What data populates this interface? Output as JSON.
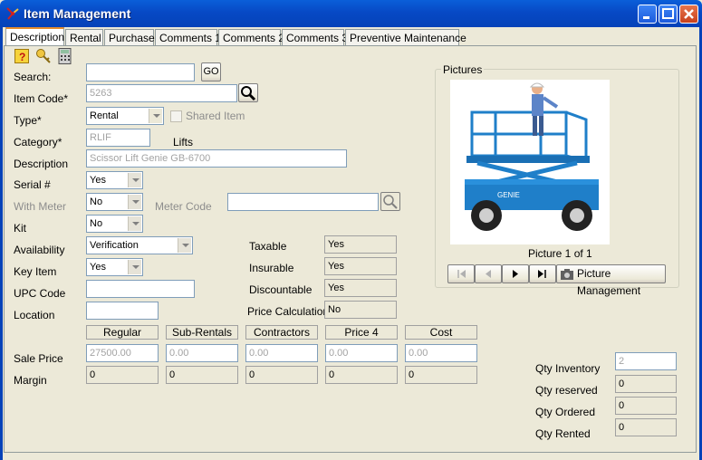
{
  "window": {
    "title": "Item Management"
  },
  "tabs": [
    "Description",
    "Rental",
    "Purchase",
    "Comments 1",
    "Comments 2",
    "Comments 3",
    "Preventive Maintenance"
  ],
  "toolbar": {
    "icons": [
      "help-icon",
      "search-key-icon",
      "calculator-icon"
    ]
  },
  "form": {
    "search_label": "Search:",
    "search_value": "",
    "go_label": "GO",
    "item_code_label": "Item Code*",
    "item_code_value": "5263",
    "type_label": "Type*",
    "type_value": "Rental",
    "shared_item_label": "Shared Item",
    "category_label": "Category*",
    "category_value": "RLIF",
    "category_name": "Lifts",
    "description_label": "Description",
    "description_value": "Scissor Lift Genie GB-6700",
    "serial_label": "Serial #",
    "serial_value": "Yes",
    "with_meter_label": "With Meter",
    "with_meter_value": "No",
    "meter_code_label": "Meter Code",
    "meter_code_value": "",
    "kit_label": "Kit",
    "kit_value": "No",
    "availability_label": "Availability",
    "availability_value": "Verification",
    "key_item_label": "Key Item",
    "key_item_value": "Yes",
    "upc_label": "UPC Code",
    "upc_value": "",
    "location_label": "Location",
    "location_value": ""
  },
  "flags": {
    "taxable_label": "Taxable",
    "taxable_value": "Yes",
    "insurable_label": "Insurable",
    "insurable_value": "Yes",
    "discountable_label": "Discountable",
    "discountable_value": "Yes",
    "price_calc_label": "Price Calculation",
    "price_calc_value": "No"
  },
  "pricing": {
    "headers": [
      "Regular",
      "Sub-Rentals",
      "Contractors",
      "Price 4",
      "Cost"
    ],
    "sale_price_label": "Sale Price",
    "sale_price": [
      "27500.00",
      "0.00",
      "0.00",
      "0.00",
      "0.00"
    ],
    "margin_label": "Margin",
    "margin": [
      "0",
      "0",
      "0",
      "0",
      "0"
    ]
  },
  "pictures": {
    "title": "Pictures",
    "counter": "Picture 1 of 1",
    "manage_label": "Picture Management",
    "lift_text": "GENIE"
  },
  "quantities": {
    "inventory_label": "Qty Inventory",
    "inventory_value": "2",
    "reserved_label": "Qty reserved",
    "reserved_value": "0",
    "ordered_label": "Qty Ordered",
    "ordered_value": "0",
    "rented_label": "Qty Rented",
    "rented_value": "0"
  },
  "colors": {
    "title_bar": "#0542b8",
    "lift_blue": "#1f7fc9",
    "active_tab_accent": "#e68b2c"
  }
}
